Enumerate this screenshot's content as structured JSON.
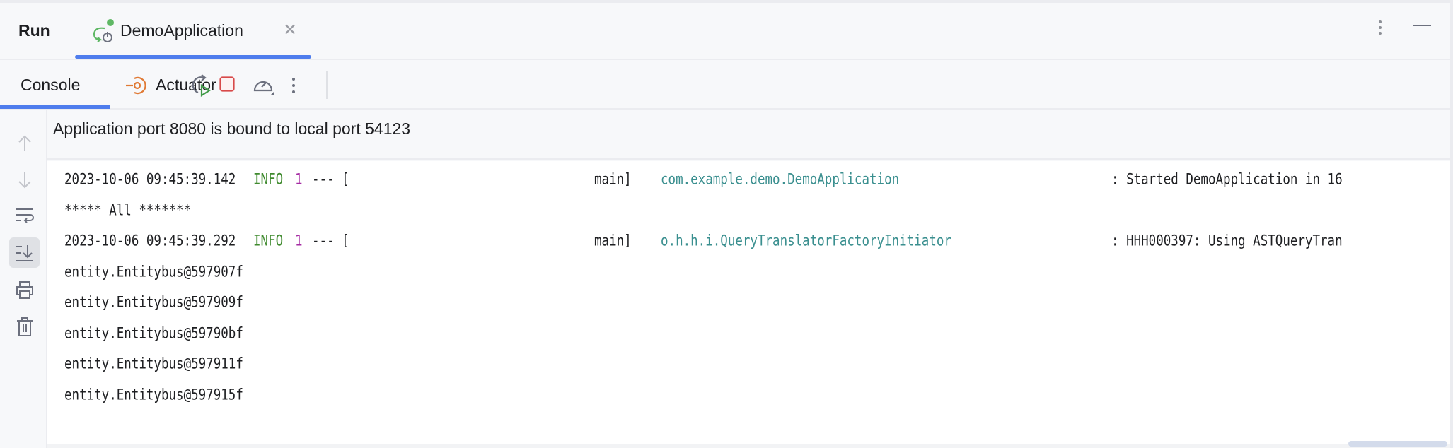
{
  "tabbar": {
    "run_label": "Run",
    "tab_label": "DemoApplication"
  },
  "toolbar": {
    "console_label": "Console",
    "actuator_label": "Actuator"
  },
  "banner": {
    "text": "Application port 8080 is bound to local port 54123"
  },
  "log": {
    "line1": {
      "timestamp": "2023-10-06 09:45:39.142",
      "level": "INFO",
      "pid": "1",
      "sep": "--- [",
      "thread": "main]",
      "logger": "com.example.demo.DemoApplication",
      "message": ": Started DemoApplication in 16"
    },
    "line2": "***** All *******",
    "line3": {
      "timestamp": "2023-10-06 09:45:39.292",
      "level": "INFO",
      "pid": "1",
      "sep": "--- [",
      "thread": "main]",
      "logger": "o.h.h.i.QueryTranslatorFactoryInitiator",
      "message": ": HHH000397: Using ASTQueryTran"
    },
    "entities": [
      "entity.Entitybus@597907f",
      "entity.Entitybus@597909f",
      "entity.Entitybus@59790bf",
      "entity.Entitybus@597911f",
      "entity.Entitybus@597915f"
    ]
  },
  "colors": {
    "accent": "#4f7ded",
    "info": "#3f8a2e",
    "pid": "#a52ba3",
    "logger": "#3a8f8f"
  }
}
